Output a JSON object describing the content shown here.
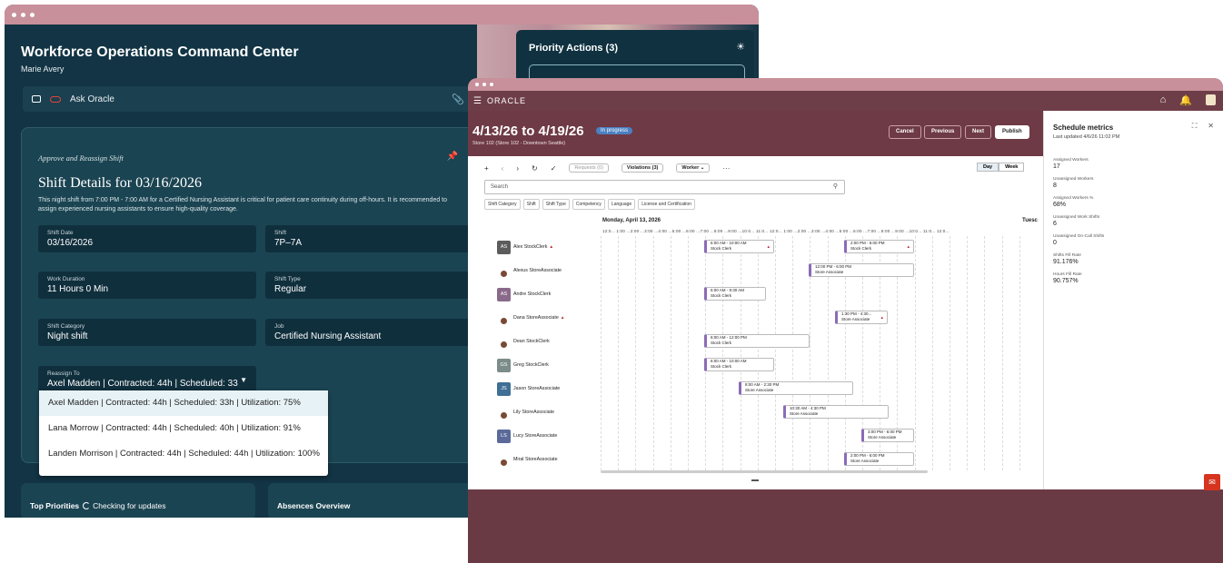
{
  "left_app": {
    "title": "Workforce Operations Command Center",
    "user": "Marie Avery",
    "ask_label": "Ask Oracle",
    "priority_title": "Priority Actions (3)",
    "card_kicker": "Approve and Reassign Shift",
    "card_title": "Shift Details for 03/16/2026",
    "card_desc": "This night shift from 7:00 PM - 7:00 AM for a Certified Nursing Assistant is critical for patient care continuity during off-hours. It is recommended to assign experienced nursing assistants to ensure high-quality coverage.",
    "fields": [
      {
        "label": "Shift Date",
        "value": "03/16/2026"
      },
      {
        "label": "Shift",
        "value": "7P–7A"
      },
      {
        "label": "Work Duration",
        "value": "11 Hours 0 Min"
      },
      {
        "label": "Shift Type",
        "value": "Regular"
      },
      {
        "label": "Shift Category",
        "value": "Night shift"
      },
      {
        "label": "Job",
        "value": "Certified Nursing Assistant"
      }
    ],
    "reassign": {
      "label": "Reassign To",
      "value": "Axel Madden | Contracted: 44h | Scheduled: 33"
    },
    "options": [
      "Axel Madden | Contracted: 44h | Scheduled: 33h | Utilization: 75%",
      "Lana Morrow | Contracted: 44h | Scheduled: 40h | Utilization: 91%",
      "Landen Morrison | Contracted: 44h | Scheduled: 44h | Utilization: 100%"
    ],
    "top_priorities": "Top Priorities",
    "checking": "Checking for updates",
    "absences": "Absences Overview"
  },
  "right_app": {
    "brand": "ORACLE",
    "date_range": "4/13/26 to 4/19/26",
    "status": "In progress",
    "store": "Store 102 (Store 102 - Downtown Seattle)",
    "buttons": {
      "cancel": "Cancel",
      "previous": "Previous",
      "next": "Next",
      "publish": "Publish"
    },
    "toolbar": {
      "requests": "Requests (0)",
      "violations": "Violations (3)",
      "worker": "Worker",
      "more": "···"
    },
    "view": {
      "day": "Day",
      "week": "Week"
    },
    "search_placeholder": "Search",
    "filters": [
      "Shift Category",
      "Shift",
      "Shift Type",
      "Competency",
      "Language",
      "License and Certification"
    ],
    "day_label": "Monday, April 13, 2026",
    "next_day_label": "Tuesc",
    "hour_labels": "12:0... 1:00 ...2:00 ...3:00 ...4:00 ...5:00 ...6:00 ...7:00 ...8:00 ...9:00 ...10:0... 11:0... 12:0... 1:00 ...2:00 ...3:00 ...4:00 ...5:00 ...6:00 ...7:00 ...8:00 ...9:00 ...10:0... 11:0... 12:0...",
    "workers": [
      {
        "name": "Alex StockClerk",
        "initials": "AS",
        "color": "#5c5c5c",
        "flag": true
      },
      {
        "name": "Alexus StoreAssociate",
        "initials": "",
        "color": "",
        "flag": false
      },
      {
        "name": "Andre StockClerk",
        "initials": "AS",
        "color": "#8a6a8a",
        "flag": false
      },
      {
        "name": "Dana StoreAssociate",
        "initials": "",
        "color": "",
        "flag": true
      },
      {
        "name": "Dean StockClerk",
        "initials": "",
        "color": "",
        "flag": false
      },
      {
        "name": "Greg StockClerk",
        "initials": "GS",
        "color": "#7b8c89",
        "flag": false
      },
      {
        "name": "Jason StoreAssociate",
        "initials": "JS",
        "color": "#3f6f95",
        "flag": false
      },
      {
        "name": "Lily StoreAssociate",
        "initials": "",
        "color": "",
        "flag": false
      },
      {
        "name": "Lucy StoreAssociate",
        "initials": "LS",
        "color": "#5b6a9a",
        "flag": false
      },
      {
        "name": "Miral StoreAssociate",
        "initials": "",
        "color": "",
        "flag": false
      }
    ],
    "shifts": [
      {
        "time": "6:00 AM - 10:00 AM",
        "role": "Stock Clerk"
      },
      {
        "time": "2:00 PM - 6:00 PM",
        "role": "Stock Clerk"
      },
      {
        "time": "12:00 PM - 6:00 PM",
        "role": "Store Associate"
      },
      {
        "time": "6:00 AM - 9:30 AM",
        "role": "Stock Clerk"
      },
      {
        "time": "1:30 PM - 4:30...",
        "role": "Store Associate"
      },
      {
        "time": "6:00 AM - 12:00 PM",
        "role": "Stock Clerk"
      },
      {
        "time": "6:00 AM - 10:00 AM",
        "role": "Stock Clerk"
      },
      {
        "time": "8:00 AM - 2:30 PM",
        "role": "Store Associate"
      },
      {
        "time": "10:30 AM - 4:30 PM",
        "role": "Store Associate"
      },
      {
        "time": "3:00 PM - 6:00 PM",
        "role": "Store Associate"
      },
      {
        "time": "2:00 PM - 6:00 PM",
        "role": "Store Associate"
      }
    ],
    "metrics": {
      "title": "Schedule metrics",
      "updated": "Last updated 4/6/26 11:02 PM",
      "items": [
        {
          "label": "Assigned Workers",
          "value": "17"
        },
        {
          "label": "Unassigned Workers",
          "value": "8"
        },
        {
          "label": "Assigned Workers %",
          "value": "68%"
        },
        {
          "label": "Unassigned Work Shifts",
          "value": "6"
        },
        {
          "label": "Unassigned On-Call Shifts",
          "value": "0"
        },
        {
          "label": "Shifts Fill Rate",
          "value": "91.176%"
        },
        {
          "label": "Hours Fill Rate",
          "value": "90.757%"
        }
      ]
    }
  }
}
